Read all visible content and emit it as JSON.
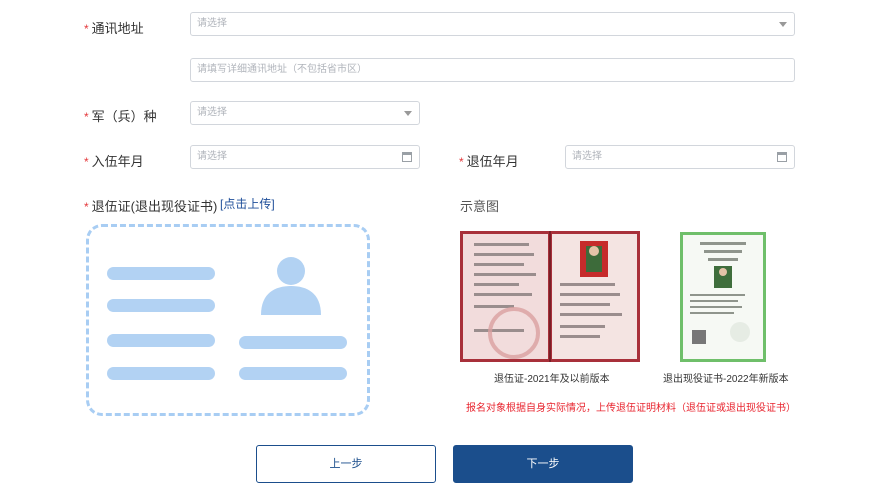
{
  "form": {
    "address": {
      "label": "通讯地址",
      "select_placeholder": "请选择",
      "detail_placeholder": "请填写详细通讯地址（不包括省市区）"
    },
    "branch": {
      "label": "军（兵）种",
      "placeholder": "请选择"
    },
    "enlist": {
      "label": "入伍年月",
      "placeholder": "请选择"
    },
    "discharge": {
      "label": "退伍年月",
      "placeholder": "请选择"
    },
    "certificate": {
      "label": "退伍证(退出现役证书)",
      "upload_link": "[点击上传]"
    }
  },
  "sample": {
    "title": "示意图",
    "old_caption": "退伍证-2021年及以前版本",
    "new_caption": "退出现役证书-2022年新版本",
    "notice": "报名对象根据自身实际情况，上传退伍证明材料（退伍证或退出现役证书）"
  },
  "buttons": {
    "prev": "上一步",
    "next": "下一步"
  },
  "colors": {
    "required": "#e4393c",
    "primary": "#1b4e8c",
    "upload_placeholder": "#b2d2f3",
    "notice": "#e8252f"
  },
  "icons": {
    "select_arrow": "chevron-down-icon",
    "date": "calendar-icon",
    "upload_placeholder": "id-card-icon"
  }
}
